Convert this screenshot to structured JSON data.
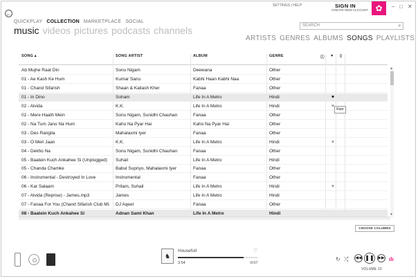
{
  "top_links": {
    "settings": "SETTINGS",
    "sep": "|",
    "help": "HELP"
  },
  "account": {
    "sign_in": "SIGN IN",
    "create": "CREATE NEW ACCOUNT"
  },
  "window_controls": [
    "–",
    "□",
    "✕"
  ],
  "nav": {
    "back": "←",
    "primary": [
      "QUICKPLAY",
      "COLLECTION",
      "MARKETPLACE",
      "SOCIAL"
    ],
    "secondary": [
      "music",
      "videos",
      "pictures",
      "podcasts",
      "channels"
    ]
  },
  "search": {
    "placeholder": "SEARCH"
  },
  "view_tabs": [
    "ARTISTS",
    "GENRES",
    "ALBUMS",
    "SONGS",
    "PLAYLISTS"
  ],
  "columns": {
    "song": "SONG",
    "artist": "SONG ARTIST",
    "album": "ALBUM",
    "genre": "GENRE",
    "info_icon": "ⓘ",
    "rate_icon": "♥",
    "device_icon": "▯"
  },
  "rows": [
    {
      "song": "Ab Mujhe Raat Din",
      "artist": "Sonu Nigam",
      "album": "Deewana",
      "genre": "Other",
      "rate": ""
    },
    {
      "song": "01 - Ae Kash Ke Hum",
      "artist": "Kumar Sanu",
      "album": "Kabhi Haan Kabhi Naa",
      "genre": "Other",
      "rate": ""
    },
    {
      "song": "01 - Chand Sifarish",
      "artist": "Shaan & Kailash Kher",
      "album": "Fanaa",
      "genre": "Other",
      "rate": ""
    },
    {
      "song": "01 - In Dino",
      "artist": "Soham",
      "album": "Life In A Metro",
      "genre": "Hindi",
      "rate": "♥"
    },
    {
      "song": "02 - Alvida",
      "artist": "K.K.",
      "album": "Life In A Metro",
      "genre": "Hindi",
      "rate": "♥"
    },
    {
      "song": "02 - Mere Haath Mein",
      "artist": "Sonu Nigam, Sunidhi Chauhan",
      "album": "Fanaa",
      "genre": "Other",
      "rate": ""
    },
    {
      "song": "02 - Na Tum Jano Na Hum",
      "artist": "Kaho Na Pyar Hai",
      "album": "Kaho Na Pyar Hai",
      "genre": "Other",
      "rate": ""
    },
    {
      "song": "03 - Des Rangila",
      "artist": "Mahalaxmi Iyer",
      "album": "Fanaa",
      "genre": "Other",
      "rate": ""
    },
    {
      "song": "03 - O Meri Jaan",
      "artist": "K.K.",
      "album": "Life In A Metro",
      "genre": "Hindi",
      "rate": "♥"
    },
    {
      "song": "04 - Dekho Na",
      "artist": "Sonu Nigam, Sunidhi Chauhan",
      "album": "Fanaa",
      "genre": "Other",
      "rate": ""
    },
    {
      "song": "05 - Baatein Kuch Ankahee Si (Unplugged)",
      "artist": "Suhail",
      "album": "Life In A Metro",
      "genre": "Hindi",
      "rate": ""
    },
    {
      "song": "05 - Chanda Chamke",
      "artist": "Babul Supriyo, Mahalaxmi Iyer",
      "album": "Fanaa",
      "genre": "Other",
      "rate": ""
    },
    {
      "song": "06 - Instrumental - Destroyed In Love",
      "artist": "Instrumental",
      "album": "Fanaa",
      "genre": "Other",
      "rate": ""
    },
    {
      "song": "06 - Kar Salaam",
      "artist": "Pritam, Suhail",
      "album": "Life In A Metro",
      "genre": "Hindi",
      "rate": "♥"
    },
    {
      "song": "07 - Alvida (Reprise) - James.mp3",
      "artist": "James",
      "album": "Life In A Metro",
      "genre": "Hindi",
      "rate": ""
    },
    {
      "song": "07 - Fanaa For You (Chand Sifarish Club Mix)",
      "artist": "DJ Aqeel",
      "album": "Fanaa",
      "genre": "Other",
      "rate": ""
    },
    {
      "song": "08 - Baatein Kuch Ankahee Si",
      "artist": "Adnan Sami Khan",
      "album": "Life In A Metro",
      "genre": "Hindi",
      "rate": ""
    }
  ],
  "tooltip": "Rate",
  "choose_columns": "CHOOSE COLUMNS",
  "now_playing": {
    "title": "Housefull",
    "elapsed": "3:54",
    "remaining": "-0:07",
    "progress": 0.83,
    "heart": "♡",
    "art": "♞"
  },
  "player": {
    "repeat": "↻",
    "shuffle": "⤮",
    "prev": "◀◀",
    "play": "❚❚",
    "next": "▶▶",
    "volume_label": "VOLUME 10",
    "eq": "ılı"
  }
}
